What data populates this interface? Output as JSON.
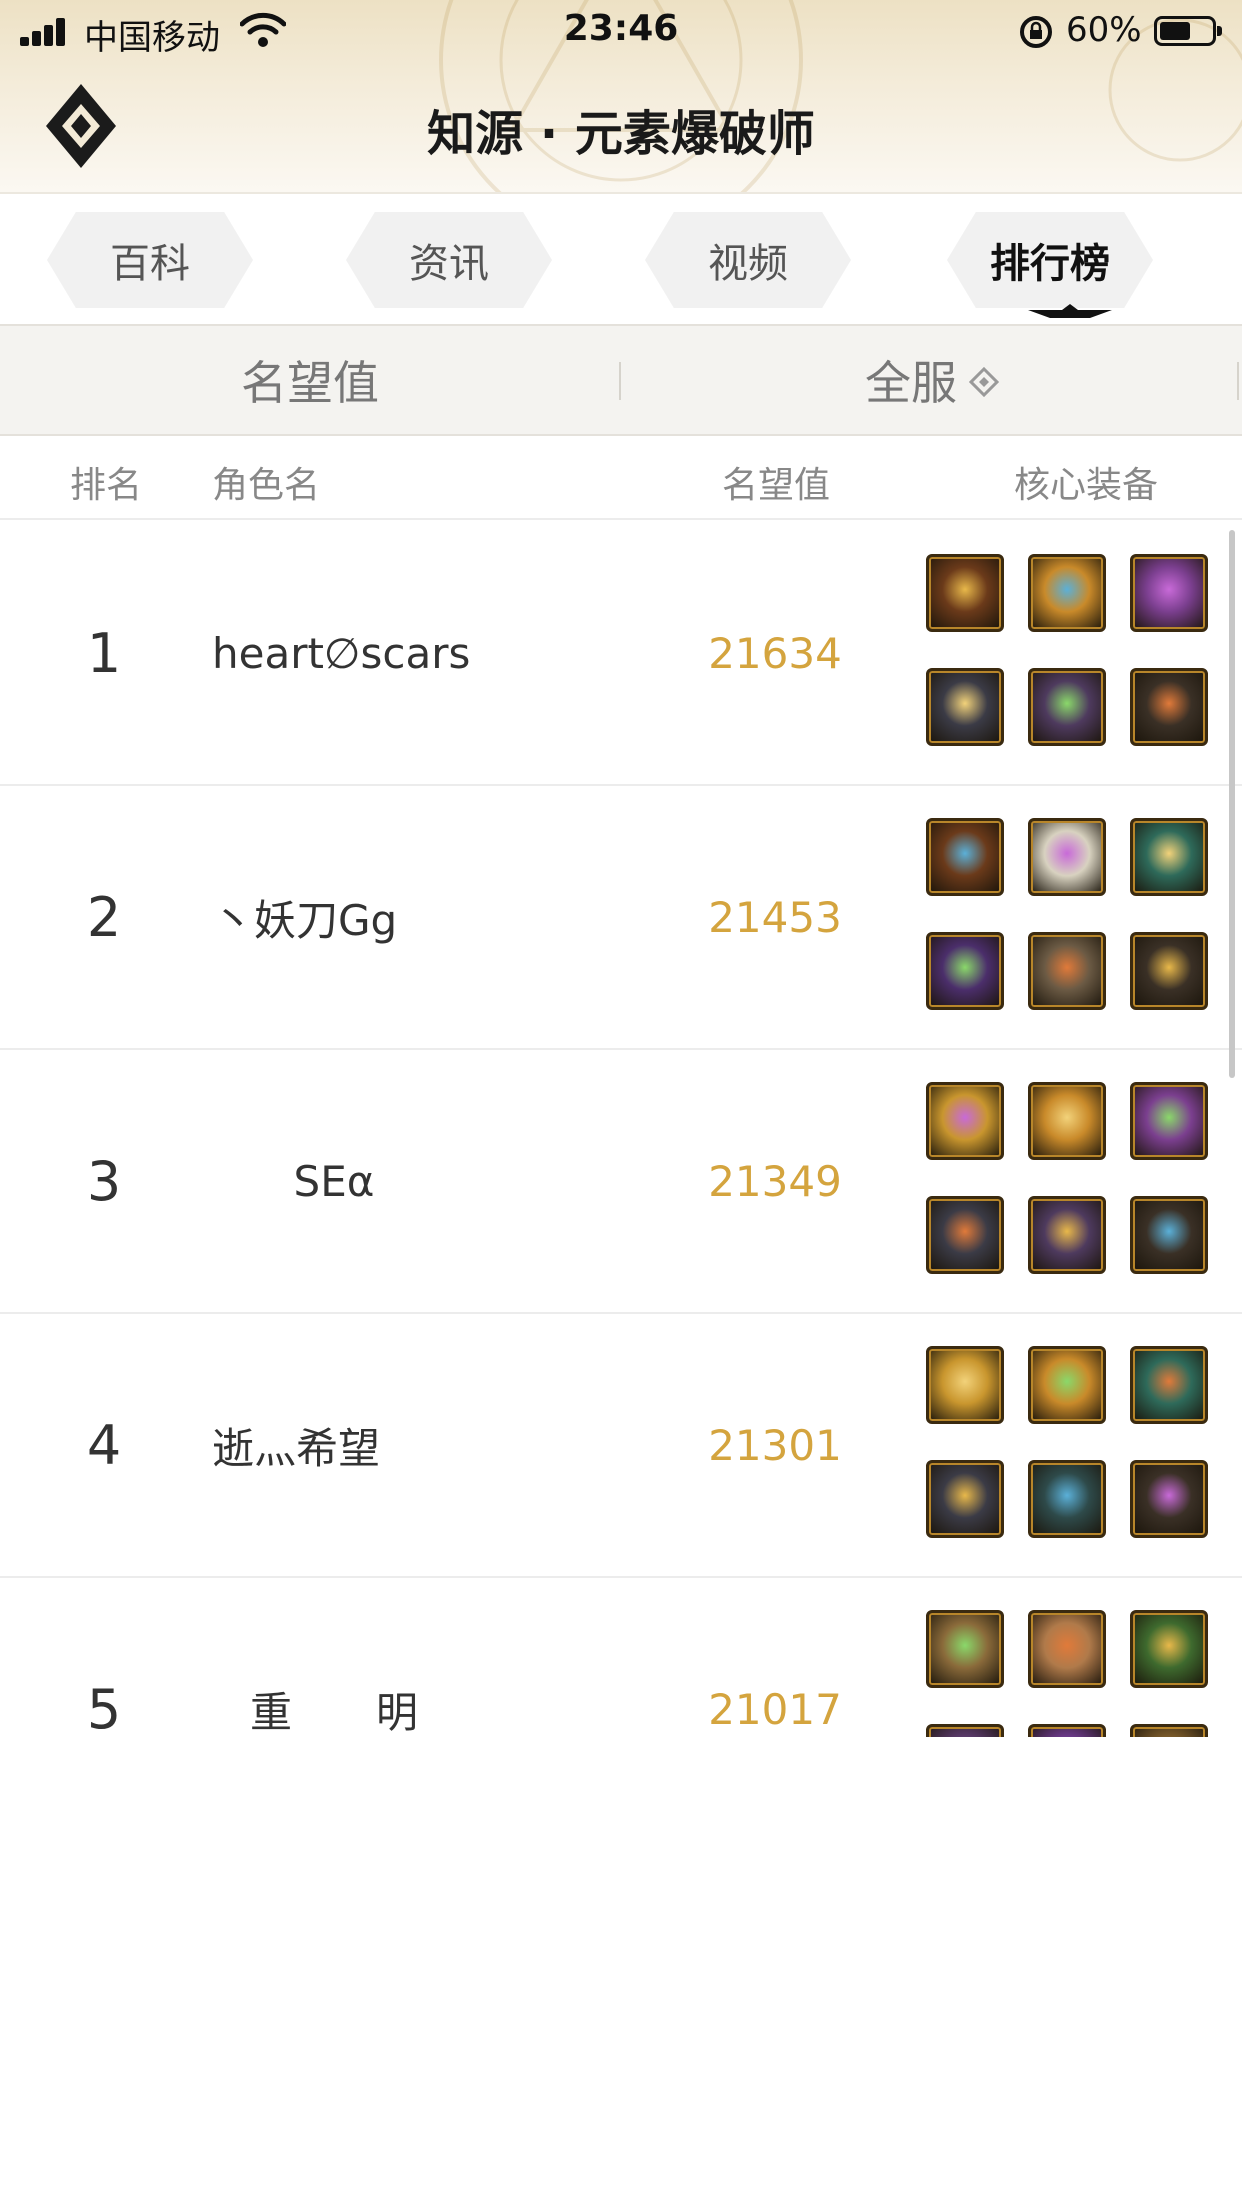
{
  "status_bar": {
    "carrier": "中国移动",
    "time": "23:46",
    "battery_percent": "60%",
    "battery_level": 0.6
  },
  "header": {
    "title": "知源 · 元素爆破师"
  },
  "tabs": [
    {
      "label": "百科",
      "active": false
    },
    {
      "label": "资讯",
      "active": false
    },
    {
      "label": "视频",
      "active": false
    },
    {
      "label": "排行榜",
      "active": true
    }
  ],
  "filters": {
    "category": "名望值",
    "server": "全服"
  },
  "table": {
    "headers": {
      "rank": "排名",
      "name": "角色名",
      "score": "名望值",
      "equipment": "核心装备"
    },
    "rows": [
      {
        "rank": "1",
        "name": "heart∅scars",
        "score": "21634"
      },
      {
        "rank": "2",
        "name": "丶妖刀Gg",
        "score": "21453"
      },
      {
        "rank": "3",
        "name": "SEα",
        "score": "21349"
      },
      {
        "rank": "4",
        "name": "逝灬希望",
        "score": "21301"
      },
      {
        "rank": "5",
        "name": "重　　明",
        "score": "21017"
      }
    ]
  },
  "colors": {
    "accent_gold": "#d4a43e",
    "header_bg": "#f4ecda",
    "text_dark": "#1a1a1a"
  }
}
